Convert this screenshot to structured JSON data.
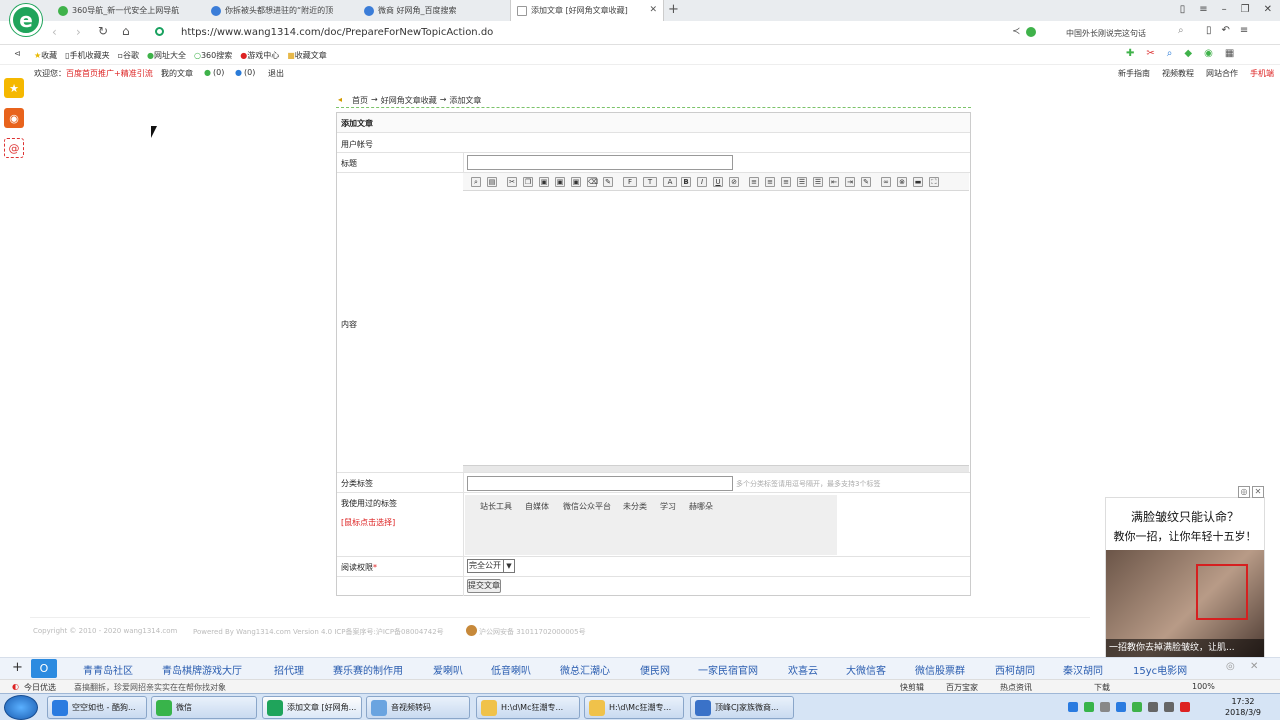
{
  "browser": {
    "tabs": [
      {
        "label": "360导航_新一代安全上网导航",
        "color": "#3fb24a"
      },
      {
        "label": "你拆被头都想进驻的“附近的顶",
        "color": "#3b7dd8"
      },
      {
        "label": "微商 好网角_百度搜索",
        "color": "#3b7dd8"
      },
      {
        "label": "添加文章 [好网角文章收藏]",
        "color": "#999999"
      }
    ],
    "new_tab": "+",
    "url": "https://www.wang1314.com/doc/PrepareForNewTopicAction.do",
    "search_hint": "中国外长刚说完这句话",
    "favorites": [
      "收藏",
      "手机收藏夹",
      "谷歌",
      "网址大全",
      "360搜索",
      "游戏中心",
      "收藏文章"
    ]
  },
  "site": {
    "welcome": "欢迎您：",
    "promo": "百度首页推广+精准引流",
    "my_articles": "我的文章",
    "count_a": "(0)",
    "count_b": "(0)",
    "logout": "退出",
    "right_links": [
      "新手指南",
      "视频教程",
      "网站合作",
      "手机端"
    ]
  },
  "breadcrumb": {
    "home": "首页",
    "arrow": "→",
    "section": "好网角文章收藏",
    "page": "添加文章"
  },
  "form": {
    "title": "添加文章",
    "user_label": "用户帐号",
    "title_label": "标题",
    "content_label": "内容",
    "category_label": "分类标签",
    "category_hint": "多个分类标签请用逗号隔开，最多支持3个标签",
    "used_tags_label": "我使用过的标签",
    "used_tags_hint": "[鼠标点击选择]",
    "used_tags": [
      "站长工具",
      "自媒体",
      "微信公众平台",
      "未分类",
      "学习",
      "赫哪朵"
    ],
    "read_label": "阅读权限",
    "read_required": "*",
    "read_value": "完全公开",
    "submit": "提交文章"
  },
  "footer": {
    "copyright": "Copyright © 2010 - 2020 wang1314.com",
    "powered": "Powered By Wang1314.com Version 4.0 ICP备案序号:沪ICP备08004742号",
    "police": "沪公网安备 31011702000005号"
  },
  "ad": {
    "headline": "满脸皱纹只能认命？",
    "subline": "教你一招，让你年轻十五岁！",
    "caption": "一招教你去掉满脸皱纹，让肌..."
  },
  "bottom_links": [
    "青青岛社区",
    "青岛棋牌游戏大厅",
    "招代理",
    "赛乐赛的制作用",
    "爱喇叭",
    "低音喇叭",
    "微总汇潮心",
    "便民网",
    "一家民宿官网",
    "欢喜云",
    "大微信客",
    "微信股票群",
    "西柯胡同",
    "秦汉胡同",
    "15yc电影网"
  ],
  "status": {
    "left1": "今日优选",
    "left2": "喜搞翻拆，珍爱网招亲实实在在帮你找对象",
    "right": [
      "快剪辑",
      "百万宝家",
      "热点资讯",
      "下载",
      "100%"
    ]
  },
  "taskbar": {
    "items": [
      "空空如也 - 酷狗...",
      "微信",
      "添加文章 [好网角...",
      "音视频转码",
      "H:\\d\\Mc狂潮专...",
      "H:\\d\\Mc狂潮专...",
      "顶峰CJ家族微商..."
    ],
    "time": "17:32",
    "date": "2018/3/9"
  }
}
